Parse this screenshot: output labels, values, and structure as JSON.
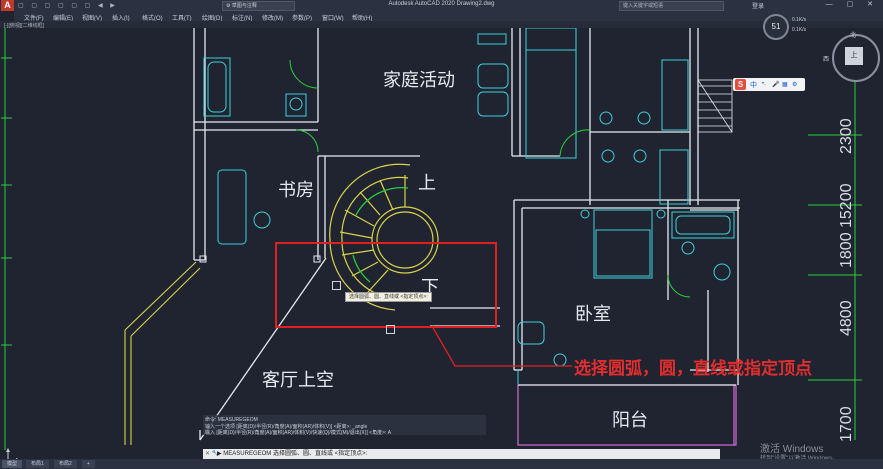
{
  "titlebar": {
    "app_logo": "A",
    "quick_access": "▢ ▢ ▢ ▢ ▢ ▢ ◀ ▶",
    "workspace": "⚙ 草图与注释",
    "title": "Autodesk AutoCAD 2020   Drawing2.dwg",
    "search_placeholder": "键入关键字或短语",
    "user": "登录",
    "window_controls": "— ▢ ✕"
  },
  "menubar": {
    "items": [
      "文件(F)",
      "编辑(E)",
      "视图(V)",
      "插入(I)",
      "格式(O)",
      "工具(T)",
      "绘图(D)",
      "标注(N)",
      "修改(M)",
      "参数(P)",
      "窗口(W)",
      "帮助(H)"
    ]
  },
  "doc_tab": "[-][俯视][二维线框]",
  "nav_widget": {
    "percent": "51",
    "v1": "0.1K/s",
    "v2": "0.1K/s"
  },
  "ime_toolbar": {
    "logo": "S",
    "lang": "中",
    "i1": "•,",
    "i2": "🎤",
    "i3": "▦",
    "i4": "⚙"
  },
  "viewcube": {
    "north": "北",
    "west": "西",
    "face": "上"
  },
  "drawing": {
    "labels": {
      "family_activity": "家庭活动",
      "study": "书房",
      "up": "上",
      "down": "下",
      "bedroom": "卧室",
      "living_void": "客厅上空",
      "balcony": "阳台"
    },
    "dimensions": {
      "d1": "2300",
      "d2": "15200",
      "d3": "1800",
      "d4": "4800",
      "d5": "1700"
    }
  },
  "tooltip": "选择圆弧、圆、直线或 <指定顶点>:",
  "annotation": "选择圆弧，圆，直线或指定顶点",
  "command_history": {
    "line1": "命令: MEASUREGEOM",
    "line2": "输入一个选项 [距离(D)/半径(R)/角度(A)/面积(AR)/体积(V)] <距离>: _angle",
    "line3": "输入 [距离(D)/半径(R)/角度(A)/面积(AR)/体积(V)/快速(Q)/模式(M)/退出(X)] <角度>: A"
  },
  "command_line": {
    "icon": "✕ 🔧",
    "text": "▶ MEASUREGEOM 选择圆弧、圆、直线或 <指定顶点>:"
  },
  "watermark": {
    "line1": "激活 Windows",
    "line2": "转到\"设置\"以激活 Windows。"
  },
  "layout_tabs": [
    "模型",
    "布局1",
    "布局2",
    "+"
  ],
  "colors": {
    "background": "#1f2430",
    "highlight_rect": "#e02020",
    "annotation": "#e02d2d",
    "walls": "#e6e9ef",
    "stairs": "#d9d34a",
    "cyan": "#3fd0d8",
    "green": "#29d03a",
    "magenta": "#d36ad8"
  }
}
